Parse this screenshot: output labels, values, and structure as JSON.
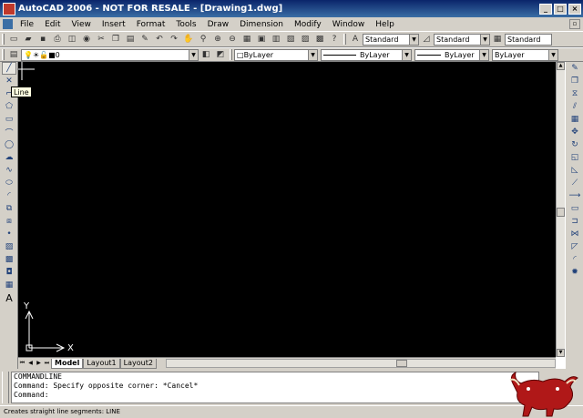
{
  "window": {
    "title": "AutoCAD 2006 - NOT FOR RESALE - [Drawing1.dwg]"
  },
  "menu": [
    "File",
    "Edit",
    "View",
    "Insert",
    "Format",
    "Tools",
    "Draw",
    "Dimension",
    "Modify",
    "Window",
    "Help"
  ],
  "styles": {
    "text_style": "Standard",
    "dim_style": "Standard",
    "table_style": "Standard"
  },
  "layer": {
    "current": "0"
  },
  "properties": {
    "color": "ByLayer",
    "linetype": "ByLayer",
    "lineweight": "ByLayer",
    "plot_style": "ByLayer"
  },
  "tooltip": "Line",
  "ucs": {
    "x_label": "X",
    "y_label": "Y"
  },
  "tabs": [
    "Model",
    "Layout1",
    "Layout2"
  ],
  "active_tab": "Model",
  "command": {
    "header": "COMMANDLINE",
    "history": "Command: Specify opposite corner: *Cancel*",
    "prompt": "Command:"
  },
  "status": "Creates straight line segments:  LINE",
  "colors": {
    "canvas": "#000000",
    "chrome": "#d4d0c8",
    "titlebar": "#0a246a"
  }
}
